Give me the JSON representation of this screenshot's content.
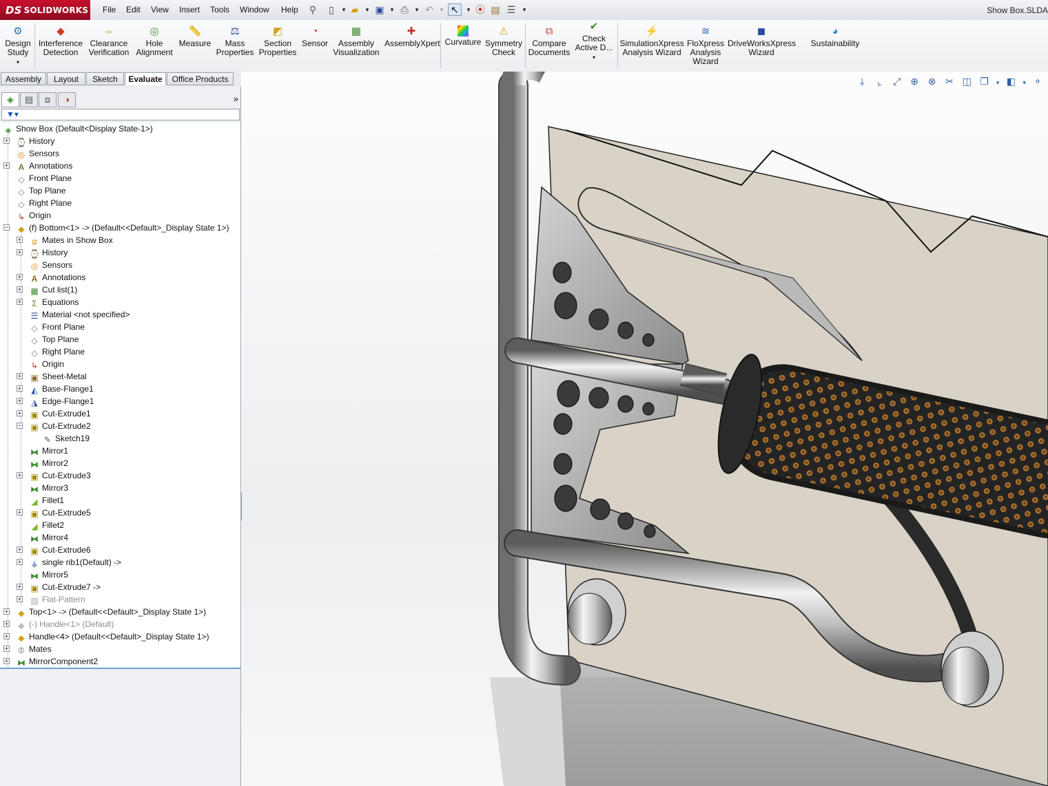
{
  "app": {
    "brand": "SOLIDWORKS",
    "brand_prefix": "DS",
    "document_title": "Show Box.SLDA"
  },
  "menu": [
    "File",
    "Edit",
    "View",
    "Insert",
    "Tools",
    "Window",
    "Help"
  ],
  "command_manager": {
    "items": [
      {
        "label1": "Design",
        "label2": "Study",
        "icon": "design-study-icon"
      },
      {
        "label1": "Interference",
        "label2": "Detection",
        "icon": "interference-icon"
      },
      {
        "label1": "Clearance",
        "label2": "Verification",
        "icon": "clearance-icon"
      },
      {
        "label1": "Hole",
        "label2": "Alignment",
        "icon": "hole-alignment-icon"
      },
      {
        "label1": "Measure",
        "label2": "",
        "icon": "measure-icon"
      },
      {
        "label1": "Mass",
        "label2": "Properties",
        "icon": "mass-properties-icon"
      },
      {
        "label1": "Section",
        "label2": "Properties",
        "icon": "section-properties-icon"
      },
      {
        "label1": "Sensor",
        "label2": "",
        "icon": "sensor-icon"
      },
      {
        "label1": "Assembly",
        "label2": "Visualization",
        "icon": "assembly-visualization-icon"
      },
      {
        "label1": "AssemblyXpert",
        "label2": "",
        "icon": "assemblyxpert-icon"
      },
      {
        "label1": "Curvature",
        "label2": "",
        "icon": "curvature-icon"
      },
      {
        "label1": "Symmetry",
        "label2": "Check",
        "icon": "symmetry-check-icon"
      },
      {
        "label1": "Compare",
        "label2": "Documents",
        "icon": "compare-documents-icon"
      },
      {
        "label1": "Check",
        "label2": "Active D...",
        "icon": "check-active-icon"
      },
      {
        "label1": "SimulationXpress",
        "label2": "Analysis Wizard",
        "icon": "simulationxpress-icon"
      },
      {
        "label1": "FloXpress",
        "label2": "Analysis",
        "label3": "Wizard",
        "icon": "floxpress-icon"
      },
      {
        "label1": "DriveWorksXpress",
        "label2": "Wizard",
        "icon": "driveworksxpress-icon"
      },
      {
        "label1": "Sustainability",
        "label2": "",
        "icon": "sustainability-icon"
      }
    ]
  },
  "tabs": [
    "Assembly",
    "Layout",
    "Sketch",
    "Evaluate",
    "Office Products"
  ],
  "active_tab": "Evaluate",
  "tree": {
    "root": "Show Box  (Default<Display State-1>)",
    "items": [
      {
        "label": "History",
        "icon": "history-icon"
      },
      {
        "label": "Sensors",
        "icon": "sensors-icon"
      },
      {
        "label": "Annotations",
        "icon": "annotations-icon"
      },
      {
        "label": "Front Plane",
        "icon": "plane-icon"
      },
      {
        "label": "Top Plane",
        "icon": "plane-icon"
      },
      {
        "label": "Right Plane",
        "icon": "plane-icon"
      },
      {
        "label": "Origin",
        "icon": "origin-icon"
      },
      {
        "label": "(f) Bottom<1> -> (Default<<Default>_Display State 1>)",
        "icon": "part-icon"
      },
      {
        "label": "Mates in Show Box",
        "icon": "mates-icon"
      },
      {
        "label": "History",
        "icon": "history-icon"
      },
      {
        "label": "Sensors",
        "icon": "sensors-icon"
      },
      {
        "label": "Annotations",
        "icon": "annotations-icon"
      },
      {
        "label": "Cut list(1)",
        "icon": "cut-list-icon"
      },
      {
        "label": "Equations",
        "icon": "equations-icon"
      },
      {
        "label": "Material <not specified>",
        "icon": "material-icon"
      },
      {
        "label": "Front Plane",
        "icon": "plane-icon"
      },
      {
        "label": "Top Plane",
        "icon": "plane-icon"
      },
      {
        "label": "Right Plane",
        "icon": "plane-icon"
      },
      {
        "label": "Origin",
        "icon": "origin-icon"
      },
      {
        "label": "Sheet-Metal",
        "icon": "sheet-metal-icon"
      },
      {
        "label": "Base-Flange1",
        "icon": "base-flange-icon"
      },
      {
        "label": "Edge-Flange1",
        "icon": "edge-flange-icon"
      },
      {
        "label": "Cut-Extrude1",
        "icon": "cut-extrude-icon"
      },
      {
        "label": "Cut-Extrude2",
        "icon": "cut-extrude-icon"
      },
      {
        "label": "Sketch19",
        "icon": "sketch-icon"
      },
      {
        "label": "Mirror1",
        "icon": "mirror-icon"
      },
      {
        "label": "Mirror2",
        "icon": "mirror-icon"
      },
      {
        "label": "Cut-Extrude3",
        "icon": "cut-extrude-icon"
      },
      {
        "label": "Mirror3",
        "icon": "mirror-icon"
      },
      {
        "label": "Fillet1",
        "icon": "fillet-icon"
      },
      {
        "label": "Cut-Extrude5",
        "icon": "cut-extrude-icon"
      },
      {
        "label": "Fillet2",
        "icon": "fillet-icon"
      },
      {
        "label": "Mirror4",
        "icon": "mirror-icon"
      },
      {
        "label": "Cut-Extrude6",
        "icon": "cut-extrude-icon"
      },
      {
        "label": "single rib1(Default) ->",
        "icon": "rib-icon"
      },
      {
        "label": "Mirror5",
        "icon": "mirror-icon"
      },
      {
        "label": "Cut-Extrude7 ->",
        "icon": "cut-extrude-icon"
      },
      {
        "label": "Flat-Pattern",
        "icon": "flat-pattern-icon"
      },
      {
        "label": "Top<1> -> (Default<<Default>_Display State 1>)",
        "icon": "part-icon"
      },
      {
        "label": "(-) Handle<1> (Default)",
        "icon": "part-icon"
      },
      {
        "label": "Handle<4> (Default<<Default>_Display State 1>)",
        "icon": "part-icon"
      },
      {
        "label": "Mates",
        "icon": "mates-icon"
      },
      {
        "label": "MirrorComponent2",
        "icon": "mirror-component-icon"
      }
    ]
  },
  "colors": {
    "accent": "#1c55b8",
    "brand": "#c8102e",
    "panel_bg": "#eef0f3",
    "plate": "#d9d2c6",
    "tube": "#b8b8b8",
    "grip": "#2a2a2a",
    "grip_dots": "#b0752e"
  }
}
